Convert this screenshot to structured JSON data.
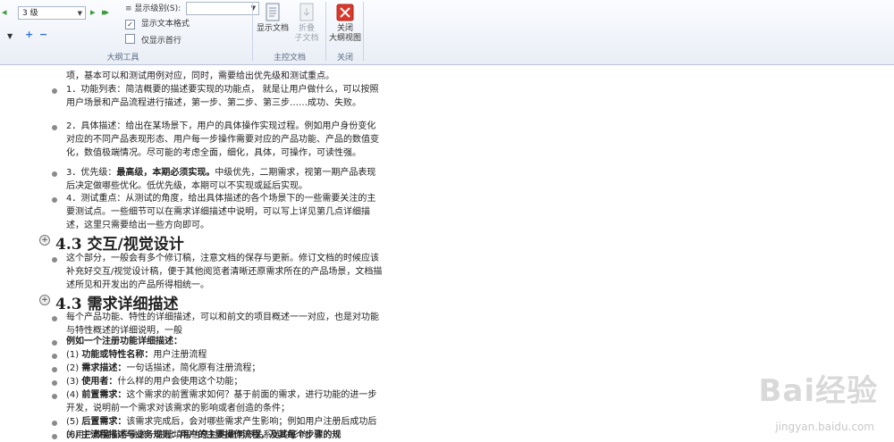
{
  "ribbon": {
    "level_select": "3 级",
    "show_level_label": "显示级别(S):",
    "show_text_format_label": "显示文本格式",
    "show_text_format_checked": true,
    "first_line_only_label": "仅显示首行",
    "first_line_only_checked": false,
    "outline_group_label": "大纲工具",
    "show_document_label": "显示文档",
    "collapse_sub_label_1": "折叠",
    "collapse_sub_label_2": "子文档",
    "master_group_label": "主控文档",
    "close_outline_label_1": "关闭",
    "close_outline_label_2": "大纲视图",
    "close_group_label": "关闭",
    "promote_glyph": "+",
    "demote_glyph": "−"
  },
  "document": {
    "intro": "项，基本可以和测试用例对应，同时，需要给出优先级和测试重点。",
    "items_1": [
      {
        "text": "1．功能列表：简洁概要的描述要实现的功能点， 就是让用户做什么，可以按照用户场景和产品流程进行描述，第一步、第二步、第三步……成功、失败。"
      },
      {
        "text": "2．具体描述：给出在某场景下，用户的具体操作实现过程。例如用户身份变化对应的不同产品表现形态、用户每一步操作需要对应的产品功能、产品的数值变化，数值极端情况。尽可能的考虑全面，细化，具体，可操作，可读性强。"
      },
      {
        "prefix": "3．优先级：",
        "bold": "最高级，本期必须实现。",
        "text": "中级优先，二期需求，视第一期产品表现后决定做哪些优化。低优先级，本期可以不实现或延后实现。"
      },
      {
        "text": "4．测试重点：从测试的角度，给出具体描述的各个场景下的一些需要关注的主要测试点。一些细节可以在需求详细描述中说明，可以写上详见第几点详细描述，这里只需要给出一些方向即可。"
      }
    ],
    "heading_1": "4.3 交互/视觉设计",
    "section_1_text": "这个部分，一般会有多个修订稿，注意文档的保存与更新。修订文档的时候应该补充好交互/视觉设计稿，便于其他阅览者清晰还原需求所在的产品场景，文档描述所见和开发出的产品所得相统一。",
    "heading_2": "4.3 需求详细描述",
    "section_2_intro": "每个产品功能、特性的详细描述，可以和前文的项目概述一一对应，也是对功能与特性概述的详细说明，一般",
    "example_title": "例如一个注册功能详细描述：",
    "details": [
      {
        "num": "(1)",
        "bold": "功能或特性名称：",
        "text": "用户注册流程"
      },
      {
        "num": "(2)",
        "bold": "需求描述：",
        "text": "一句话描述，简化原有注册流程；"
      },
      {
        "num": "(3)",
        "bold": "使用者：",
        "text": "什么样的用户会使用这个功能；"
      },
      {
        "num": "(4)",
        "bold": "前置需求：",
        "text": "这个需求的前置需求如何？基于前面的需求，进行功能的进一步开发，说明前一个需求对该需求的影响或者创造的条件；"
      },
      {
        "num": "(5)",
        "bold": "后置需求：",
        "text": "该需求完成后，会对哪些需求产生影响；例如用户注册后成功后的用户教育引导需求、注册填写信息对构建用户关系链的影响；"
      },
      {
        "num": "(6)",
        "bold": "主流程描述与业务规则：用户的主要操作流程，及其每个步骤的规",
        "text": ""
      }
    ]
  },
  "watermark": {
    "brand": "Bai经验",
    "url": "jingyan.baidu.com"
  }
}
